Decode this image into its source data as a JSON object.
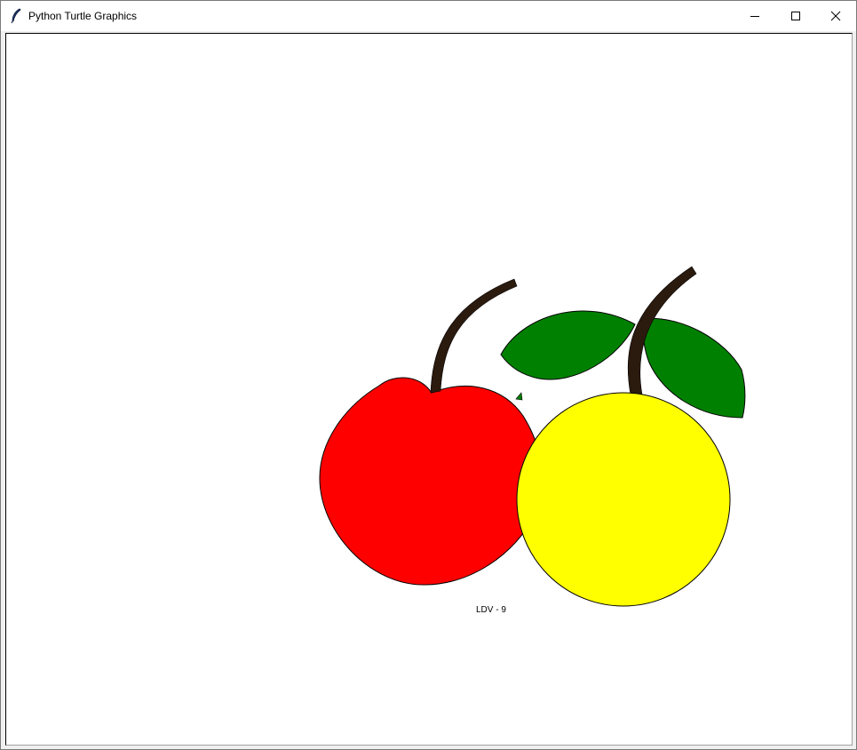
{
  "window": {
    "title": "Python Turtle Graphics",
    "app_icon": "feather-icon",
    "controls": {
      "minimize_icon": "minimize-icon",
      "maximize_icon": "maximize-icon",
      "close_icon": "close-icon"
    }
  },
  "canvas": {
    "background": "#ffffff",
    "label": "LDV - 9",
    "drawing": {
      "cherry_color": "#ff0000",
      "lemon_color": "#ffff00",
      "leaf_color": "#008000",
      "stem_color": "#2b1a0e",
      "outline_color": "#000000"
    }
  }
}
